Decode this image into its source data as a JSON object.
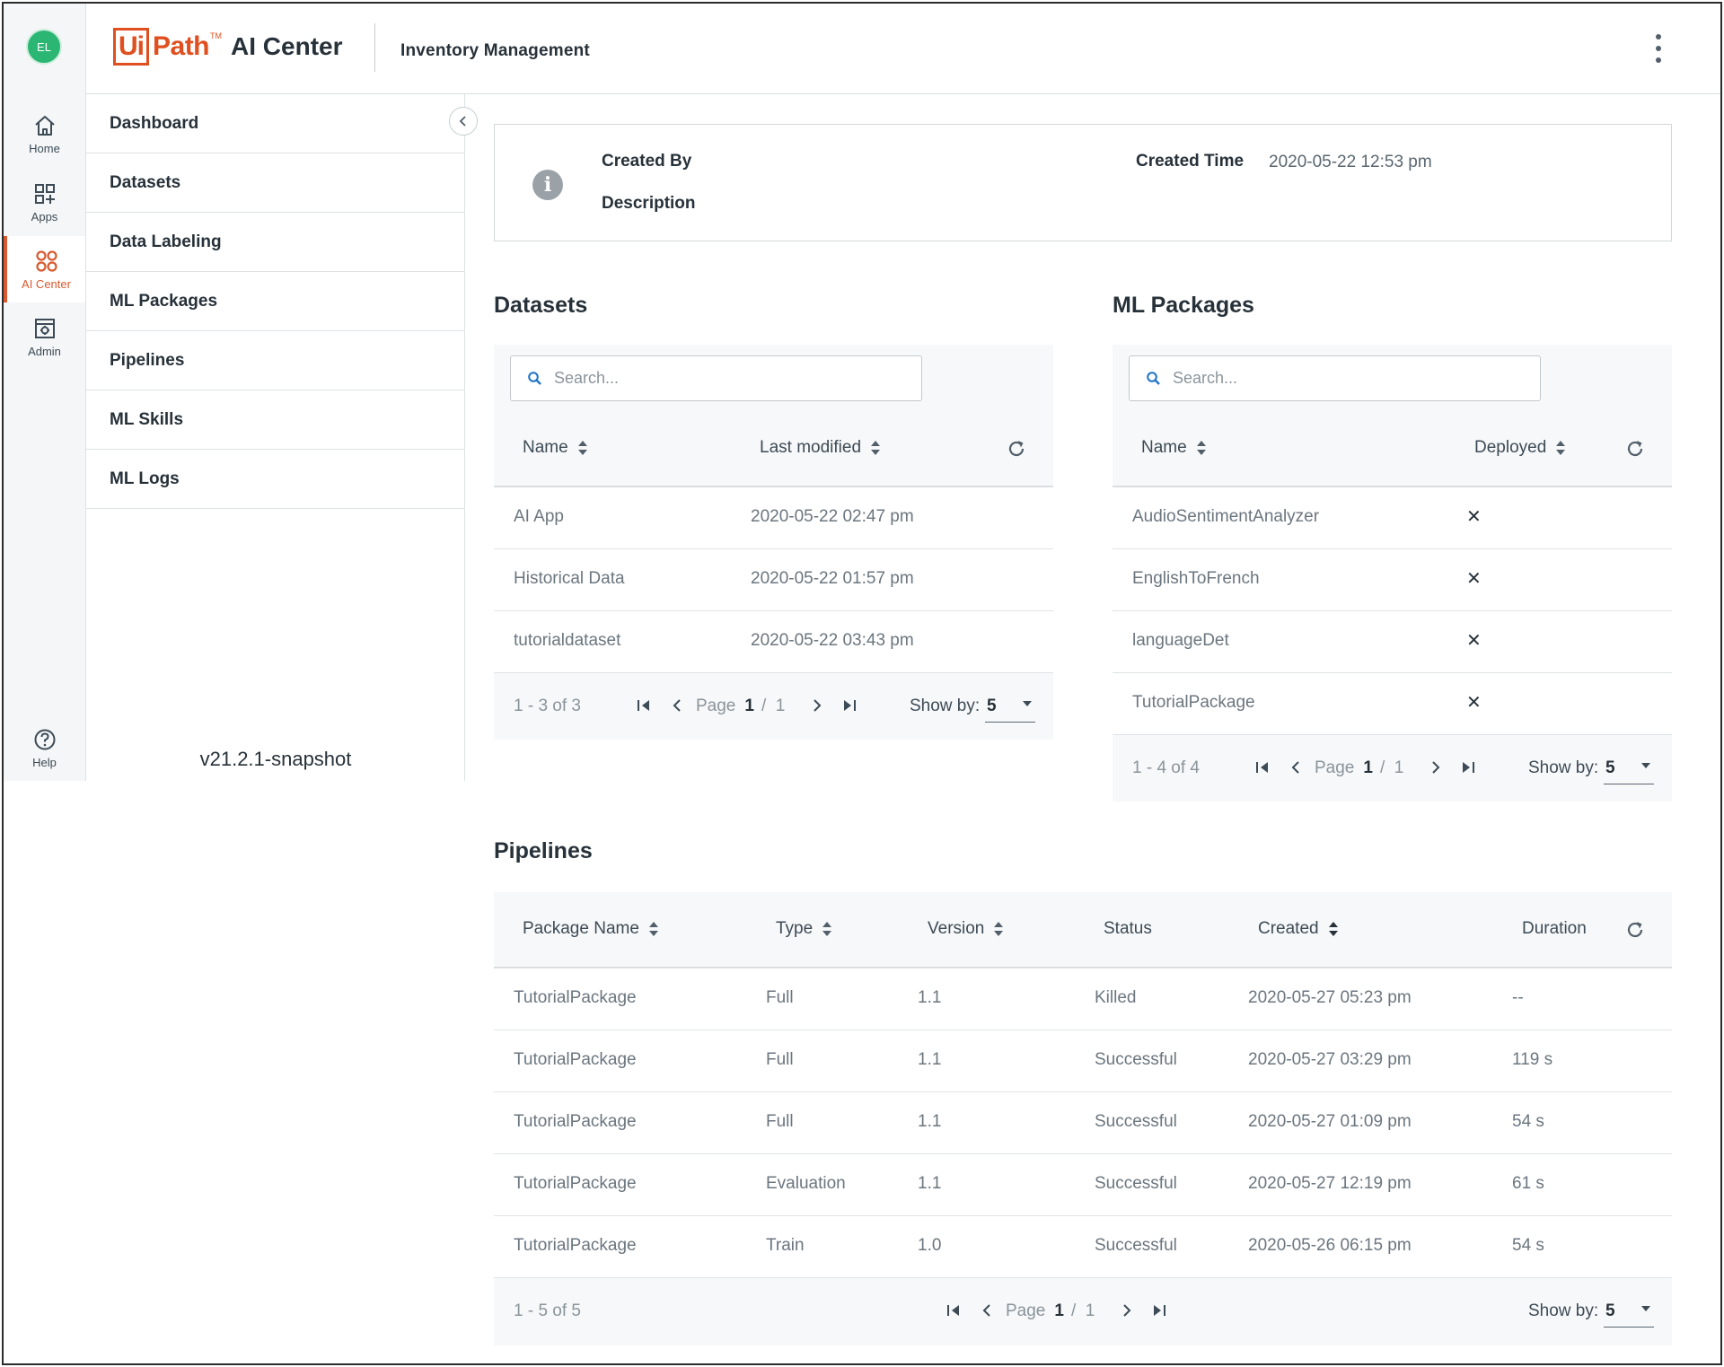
{
  "user": {
    "initials": "EL"
  },
  "rail": {
    "items": [
      {
        "label": "Home",
        "icon": "home-icon"
      },
      {
        "label": "Apps",
        "icon": "apps-icon"
      },
      {
        "label": "AI Center",
        "icon": "ai-center-icon",
        "active": true
      },
      {
        "label": "Admin",
        "icon": "admin-icon"
      }
    ],
    "help": {
      "label": "Help",
      "icon": "help-icon"
    }
  },
  "header": {
    "logo_ui": "Ui",
    "logo_path": "Path",
    "logo_tm": "TM",
    "product": "AI Center",
    "project": "Inventory Management"
  },
  "subnav": {
    "items": [
      "Dashboard",
      "Datasets",
      "Data Labeling",
      "ML Packages",
      "Pipelines",
      "ML Skills",
      "ML Logs"
    ],
    "version": "v21.2.1-snapshot"
  },
  "info": {
    "created_by_label": "Created By",
    "description_label": "Description",
    "created_time_label": "Created Time",
    "created_time_value": "2020-05-22 12:53 pm"
  },
  "datasets": {
    "title": "Datasets",
    "search_placeholder": "Search...",
    "columns": [
      "Name",
      "Last modified"
    ],
    "rows": [
      {
        "name": "AI  App",
        "modified": "2020-05-22 02:47 pm"
      },
      {
        "name": "Historical Data",
        "modified": "2020-05-22 01:57 pm"
      },
      {
        "name": "tutorialdataset",
        "modified": "2020-05-22 03:43 pm"
      }
    ],
    "pager": {
      "range": "1 - 3 of 3",
      "page_label": "Page",
      "page": "1",
      "sep": "/",
      "total": "1",
      "show_by_label": "Show by:",
      "show_by": "5"
    }
  },
  "ml_packages": {
    "title": "ML Packages",
    "search_placeholder": "Search...",
    "columns": [
      "Name",
      "Deployed"
    ],
    "rows": [
      {
        "name": "AudioSentimentAnalyzer",
        "deployed": "✕"
      },
      {
        "name": "EnglishToFrench",
        "deployed": "✕"
      },
      {
        "name": "languageDet",
        "deployed": "✕"
      },
      {
        "name": "TutorialPackage",
        "deployed": "✕"
      }
    ],
    "pager": {
      "range": "1 - 4 of 4",
      "page_label": "Page",
      "page": "1",
      "sep": "/",
      "total": "1",
      "show_by_label": "Show by:",
      "show_by": "5"
    }
  },
  "pipelines": {
    "title": "Pipelines",
    "columns": [
      "Package Name",
      "Type",
      "Version",
      "Status",
      "Created",
      "Duration"
    ],
    "rows": [
      {
        "package": "TutorialPackage",
        "type": "Full",
        "version": "1.1",
        "status": "Killed",
        "created": "2020-05-27 05:23 pm",
        "duration": "--"
      },
      {
        "package": "TutorialPackage",
        "type": "Full",
        "version": "1.1",
        "status": "Successful",
        "created": "2020-05-27 03:29 pm",
        "duration": "119 s"
      },
      {
        "package": "TutorialPackage",
        "type": "Full",
        "version": "1.1",
        "status": "Successful",
        "created": "2020-05-27 01:09 pm",
        "duration": "54 s"
      },
      {
        "package": "TutorialPackage",
        "type": "Evaluation",
        "version": "1.1",
        "status": "Successful",
        "created": "2020-05-27 12:19 pm",
        "duration": "61 s"
      },
      {
        "package": "TutorialPackage",
        "type": "Train",
        "version": "1.0",
        "status": "Successful",
        "created": "2020-05-26 06:15 pm",
        "duration": "54 s"
      }
    ],
    "pager": {
      "range": "1 - 5 of 5",
      "page_label": "Page",
      "page": "1",
      "sep": "/",
      "total": "1",
      "show_by_label": "Show by:",
      "show_by": "5"
    }
  },
  "colors": {
    "brand": "#e04f1f",
    "active": "#d85a30",
    "avatar": "#2bb673"
  }
}
